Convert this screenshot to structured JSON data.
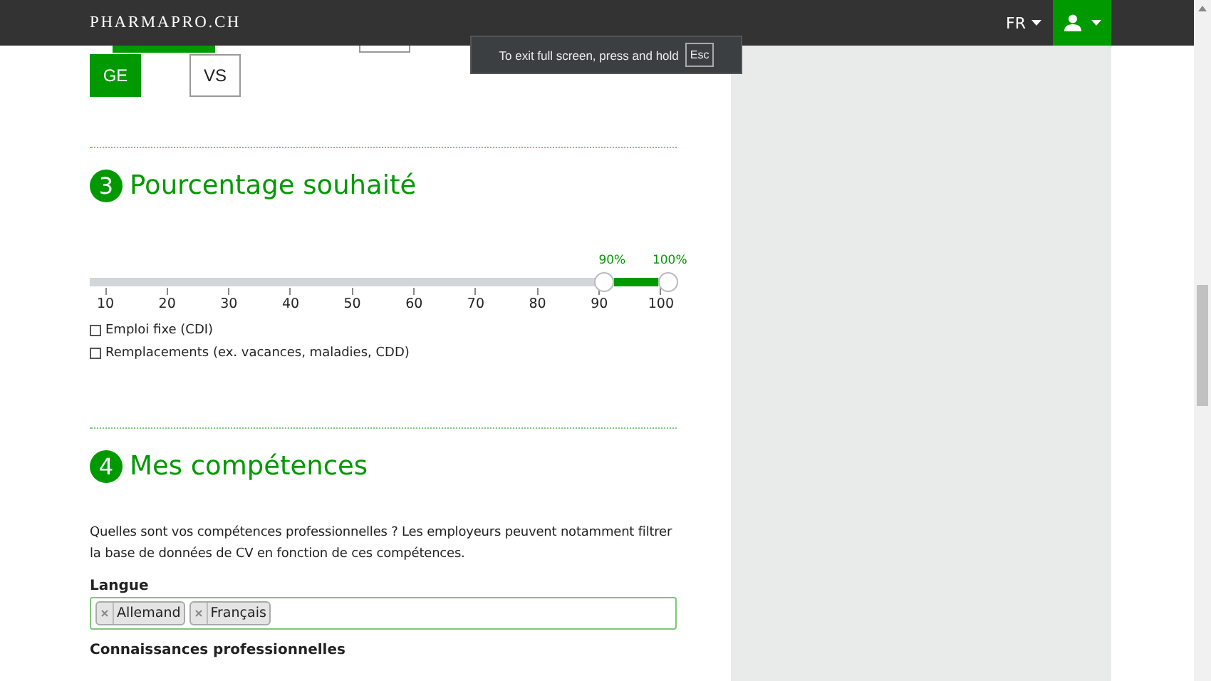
{
  "header": {
    "logo": "PHARMAPRO.CH",
    "language": "FR"
  },
  "fullscreen_notice": {
    "text": "To exit full screen, press and hold",
    "key": "Esc"
  },
  "canton_rows": [
    [
      {
        "selected": true
      },
      {
        "selected": true
      },
      {
        "selected": false
      }
    ],
    [
      {
        "label": "GE",
        "selected": true
      },
      {
        "label": "VS",
        "selected": false
      }
    ]
  ],
  "percentage_section": {
    "number": "3",
    "title": "Pourcentage souhaité",
    "slider": {
      "thumbs": [
        {
          "label": "90%",
          "level": 0.89
        },
        {
          "label": "100%",
          "level": 1
        }
      ],
      "ticks": [
        "10",
        "20",
        "30",
        "40",
        "50",
        "60",
        "70",
        "80",
        "90",
        "100"
      ]
    },
    "options": [
      {
        "label": "Emploi fixe (CDI)",
        "checked": false
      },
      {
        "label": "Remplacements (ex. vacances, maladies, CDD)",
        "checked": false
      }
    ]
  },
  "skills_section": {
    "number": "4",
    "title": "Mes compétences",
    "intro": "Quelles sont vos compétences professionnelles ? Les employeurs peuvent notamment filtrer la base de données de CV en fonction de ces compétences.",
    "fields": [
      {
        "label": "Langue",
        "tags": [
          "Allemand",
          "Français"
        ]
      },
      {
        "label": "Connaissances professionnelles"
      }
    ]
  }
}
